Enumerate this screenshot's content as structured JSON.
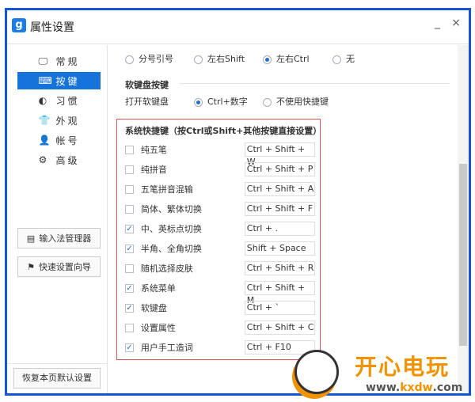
{
  "window": {
    "title": "属性设置",
    "logo": "g",
    "minimize": "_",
    "close": "×"
  },
  "sidebar": {
    "items": [
      {
        "label": "常规",
        "icon": "monitor-icon",
        "glyph": "🖵"
      },
      {
        "label": "按键",
        "icon": "keyboard-icon",
        "glyph": "⌨"
      },
      {
        "label": "习惯",
        "icon": "mouse-icon",
        "glyph": "◐"
      },
      {
        "label": "外观",
        "icon": "shirt-icon",
        "glyph": "👕"
      },
      {
        "label": "帐号",
        "icon": "user-icon",
        "glyph": "👤"
      },
      {
        "label": "高级",
        "icon": "gear-icon",
        "glyph": "⚙"
      }
    ],
    "active": 1,
    "ime_manager": "输入法管理器",
    "quick_wizard": "快速设置向导",
    "reset": "恢复本页默认设置"
  },
  "switch_options": [
    {
      "label": "分号引号",
      "checked": false
    },
    {
      "label": "左右Shift",
      "checked": false
    },
    {
      "label": "左右Ctrl",
      "checked": true
    },
    {
      "label": "无",
      "checked": false
    }
  ],
  "soft_keyboard": {
    "heading": "软键盘按键",
    "label": "打开软键盘",
    "options": [
      {
        "label": "Ctrl+数字",
        "checked": true
      },
      {
        "label": "不使用快捷键",
        "checked": false
      }
    ]
  },
  "shortcuts": {
    "heading": "系统快捷键（按Ctrl或Shift+其他按键直接设置）",
    "rows": [
      {
        "label": "纯五笔",
        "checked": false,
        "key": "Ctrl + Shift + W"
      },
      {
        "label": "纯拼音",
        "checked": false,
        "key": "Ctrl + Shift + P"
      },
      {
        "label": "五笔拼音混输",
        "checked": false,
        "key": "Ctrl + Shift + A"
      },
      {
        "label": "简体、繁体切换",
        "checked": false,
        "key": "Ctrl + Shift + F"
      },
      {
        "label": "中、英标点切换",
        "checked": true,
        "key": "Ctrl + ."
      },
      {
        "label": "半角、全角切换",
        "checked": true,
        "key": "Shift + Space"
      },
      {
        "label": "随机选择皮肤",
        "checked": false,
        "key": "Ctrl + Shift + R"
      },
      {
        "label": "系统菜单",
        "checked": true,
        "key": "Ctrl + Shift + M"
      },
      {
        "label": "软键盘",
        "checked": true,
        "key": "Ctrl + `"
      },
      {
        "label": "设置属性",
        "checked": false,
        "key": "Ctrl + Shift + C"
      },
      {
        "label": "用户手工造词",
        "checked": true,
        "key": "Ctrl + F10"
      }
    ]
  },
  "watermark": {
    "brand": "开心电玩",
    "url_prefix": "www.",
    "url_domain": "kxdw",
    ".com": ".com"
  }
}
